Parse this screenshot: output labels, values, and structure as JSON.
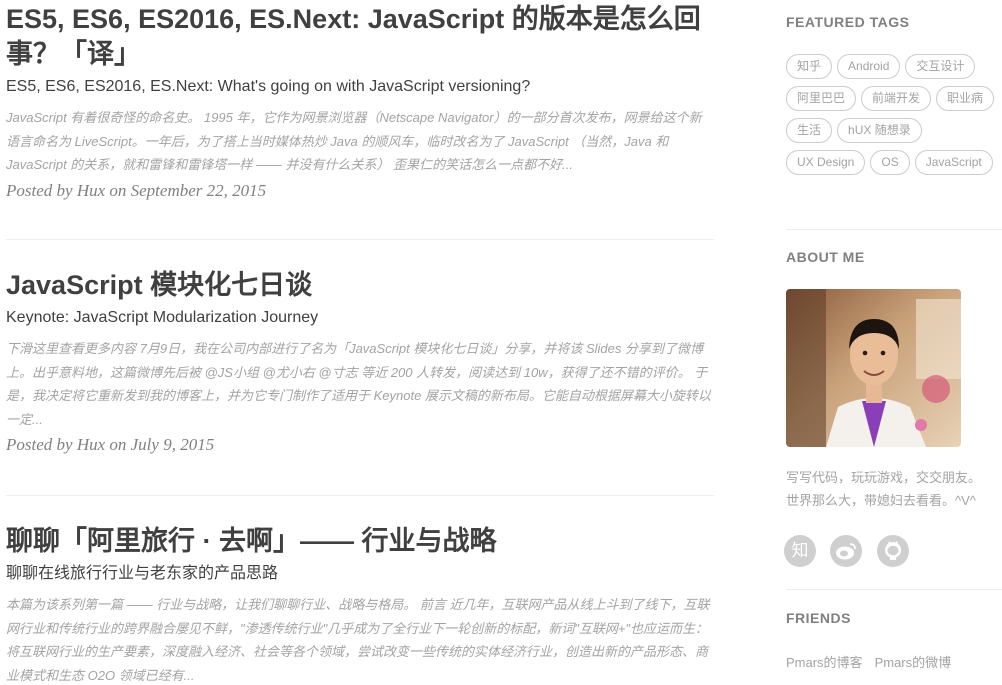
{
  "posts": [
    {
      "title": "ES5, ES6, ES2016, ES.Next: JavaScript 的版本是怎么回事？「译」",
      "subtitle": "ES5, ES6, ES2016, ES.Next: What's going on with JavaScript versioning?",
      "excerpt": "JavaScript 有着很奇怪的命名史。 1995 年，它作为网景浏览器（Netscape Navigator）的一部分首次发布，网景给这个新语言命名为 LiveScript。一年后，为了搭上当时媒体热炒 Java 的顺风车，临时改名为了 JavaScript （当然，Java 和 JavaScript 的关系，就和雷锋和雷锋塔一样 —— 并没有什么关系） 歪果仁的笑话怎么一点都不好...",
      "meta": "Posted by Hux on September 22, 2015"
    },
    {
      "title": "JavaScript 模块化七日谈",
      "subtitle": "Keynote: JavaScript Modularization Journey",
      "excerpt": "下滑这里查看更多内容 7月9日，我在公司内部进行了名为「JavaScript 模块化七日谈」分享，并将该 Slides 分享到了微博上。出乎意料地，这篇微博先后被 @JS小组 @尤小右 @寸志 等近 200 人转发，阅读达到 10w，获得了还不错的评价。 于是，我决定将它重新发到我的博客上，并为它专门制作了适用于 Keynote 展示文稿的新布局。它能自动根据屏幕大小旋转以一定...",
      "meta": "Posted by Hux on July 9, 2015"
    },
    {
      "title": "聊聊「阿里旅行 · 去啊」—— 行业与战略",
      "subtitle": "聊聊在线旅行行业与老东家的产品思路",
      "excerpt": "本篇为该系列第一篇 —— 行业与战略，让我们聊聊行业、战略与格局。 前言 近几年，互联网产品从线上斗到了线下，互联网行业和传统行业的跨界融合屡见不鲜，\"渗透传统行业\"几乎成为了全行业下一轮创新的标配，新词\"互联网+\"也应运而生： 将互联网行业的生产要素，深度融入经济、社会等各个领域，尝试改变一些传统的实体经济行业，创造出新的产品形态、商业模式和生态 O2O 领域已经有..."
    }
  ],
  "sidebar": {
    "featured_tags_title": "FEATURED TAGS",
    "tags": [
      "知乎",
      "Android",
      "交互设计",
      "阿里巴巴",
      "前端开发",
      "职业病",
      "生活",
      "hUX 随想录",
      "UX Design",
      "OS",
      "JavaScript"
    ],
    "about_title": "ABOUT ME",
    "about_line1": "写写代码，玩玩游戏，交交朋友。",
    "about_line2": "世界那么大，带媳妇去看看。^V^",
    "socials": [
      {
        "icon": "zhihu-icon",
        "glyph": "知"
      },
      {
        "icon": "weibo-icon",
        "glyph": ""
      },
      {
        "icon": "github-icon",
        "glyph": ""
      }
    ],
    "friends_title": "FRIENDS",
    "friends": [
      "Pmars的博客",
      "Pmars的微博"
    ]
  },
  "colors": {
    "text": "#404040",
    "muted": "#a3a3a3",
    "meta": "#808080",
    "border": "#eeeeee",
    "social_bg": "#cfcfcf"
  }
}
